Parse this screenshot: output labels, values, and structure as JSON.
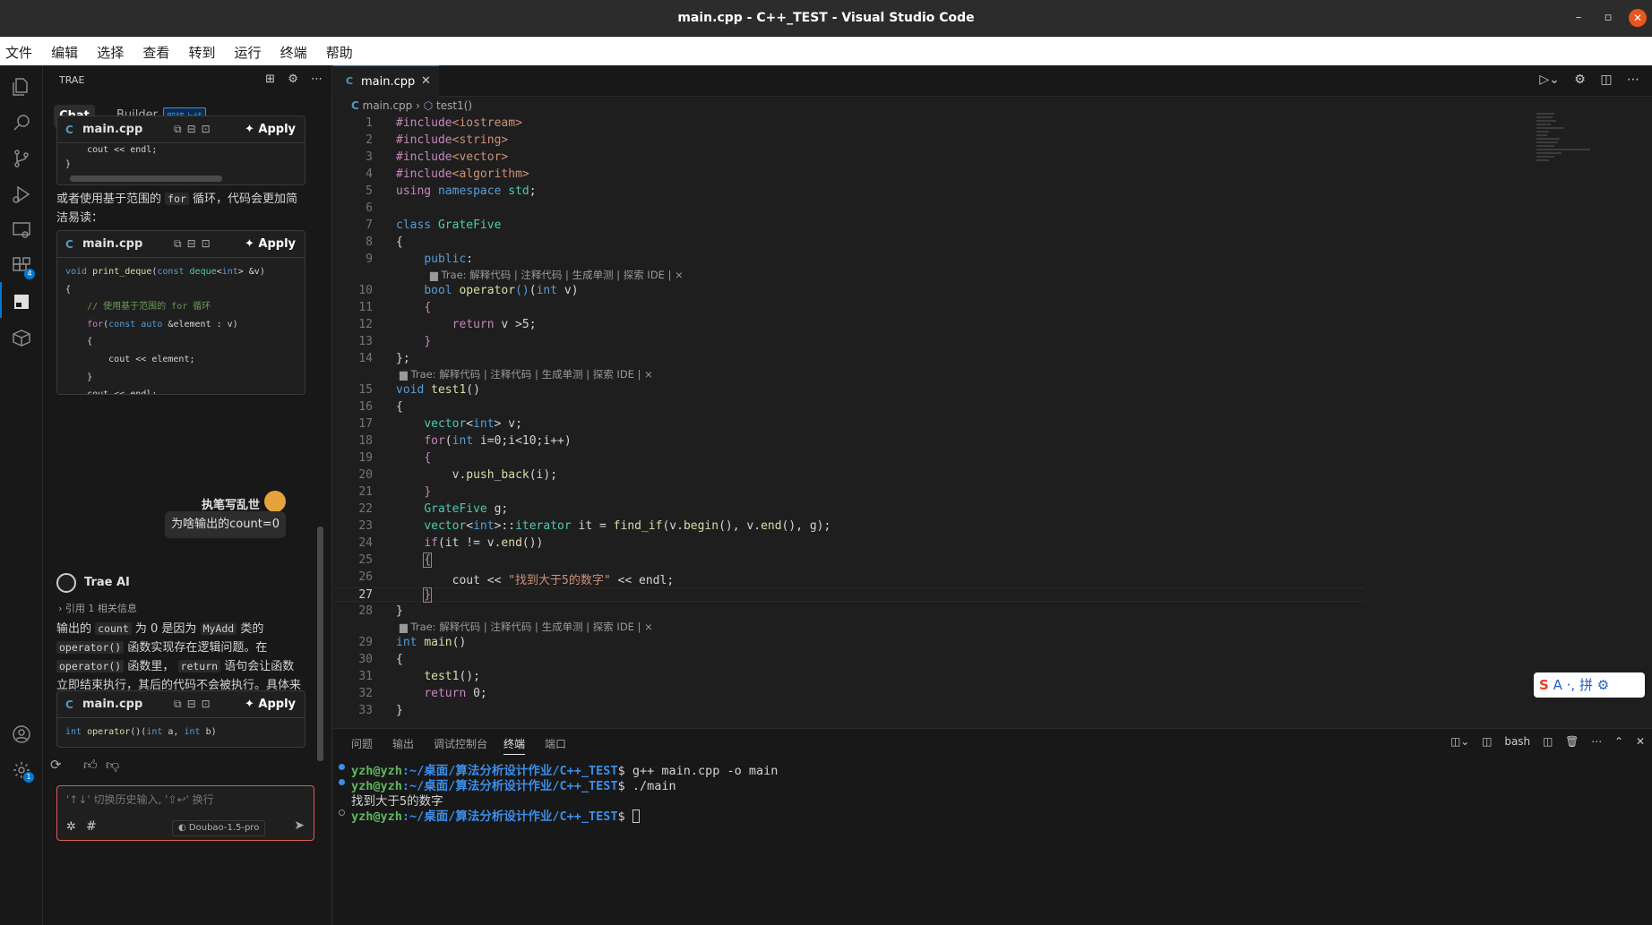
{
  "window": {
    "title": "main.cpp - C++_TEST - Visual Studio Code"
  },
  "menu": [
    "文件",
    "编辑",
    "选择",
    "查看",
    "转到",
    "运行",
    "终端",
    "帮助"
  ],
  "activity_bar": {
    "icons": [
      "files-icon",
      "search-icon",
      "source-control-icon",
      "run-debug-icon",
      "remote-explorer-icon",
      "extensions-icon",
      "trae-icon",
      "package-icon",
      "account-icon",
      "settings-icon"
    ],
    "extensions_badge": "4",
    "settings_badge": "1"
  },
  "sidebar": {
    "header": "TRAE",
    "tabs": {
      "chat": "Chat",
      "builder": "Builder",
      "builder_tag": "即将上线"
    },
    "code_cards": [
      {
        "file": "main.cpp",
        "apply": "Apply"
      },
      {
        "file": "main.cpp",
        "apply": "Apply"
      },
      {
        "file": "main.cpp",
        "apply": "Apply"
      }
    ],
    "message1": {
      "before": "或者使用基于范围的 ",
      "code": "for",
      "after": " 循环，代码会更加简洁易读："
    },
    "user": {
      "name": "执笔写乱世",
      "question": "为啥输出的count=0"
    },
    "ai": {
      "name": "Trae AI",
      "reference": "引用 1 相关信息"
    },
    "answer": {
      "t1": "输出的 ",
      "c1": "count",
      "t2": " 为 0 是因为 ",
      "c2": "MyAdd",
      "t3": " 类的 ",
      "c3": "operator()",
      "t4": " 函数实现存在逻辑问题。在 ",
      "c4": "operator()",
      "t5": " 函数里， ",
      "c5": "return",
      "t6": " 语句会让函数立即结束执行，其后的代码不会被执行。具体来看："
    },
    "input": {
      "placeholder": "'↑↓' 切换历史输入, '⇧↩' 换行",
      "model": "Doubao-1.5-pro"
    }
  },
  "editor": {
    "tab": "main.cpp",
    "breadcrumb": {
      "file": "main.cpp",
      "symbol": "test1()"
    },
    "codelens": "Trae: 解释代码 | 注释代码 | 生成单测 | 探索 IDE | ×",
    "current_line": "27"
  },
  "panel": {
    "tabs": [
      "问题",
      "输出",
      "调试控制台",
      "终端",
      "端口"
    ],
    "active_tab": "终端",
    "shell": "bash",
    "terminal": {
      "user": "yzh@yzh",
      "path": ":~/桌面/算法分析设计作业/C++_TEST",
      "cmd1": " g++ main.cpp -o main",
      "cmd2": " ./main",
      "output": "找到大于5的数字"
    }
  },
  "ime": {
    "label": "A",
    "pinyin": "拼"
  }
}
